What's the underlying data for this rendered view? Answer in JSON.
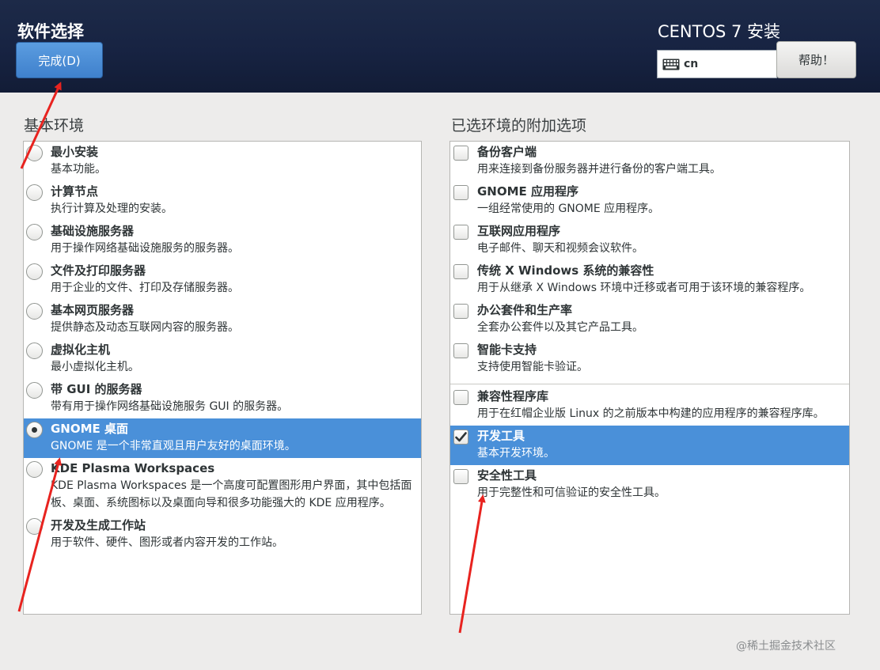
{
  "header": {
    "title": "软件选择",
    "done_label": "完成(D)",
    "product": "CENTOS 7 安装",
    "keyboard_layout": "cn",
    "help_label": "帮助！"
  },
  "base_env": {
    "heading": "基本环境",
    "items": [
      {
        "title": "最小安装",
        "desc": "基本功能。",
        "selected": false
      },
      {
        "title": "计算节点",
        "desc": "执行计算及处理的安装。",
        "selected": false
      },
      {
        "title": "基础设施服务器",
        "desc": "用于操作网络基础设施服务的服务器。",
        "selected": false
      },
      {
        "title": "文件及打印服务器",
        "desc": "用于企业的文件、打印及存储服务器。",
        "selected": false
      },
      {
        "title": "基本网页服务器",
        "desc": "提供静态及动态互联网内容的服务器。",
        "selected": false
      },
      {
        "title": "虚拟化主机",
        "desc": "最小虚拟化主机。",
        "selected": false
      },
      {
        "title": "带 GUI 的服务器",
        "desc": "带有用于操作网络基础设施服务 GUI 的服务器。",
        "selected": false
      },
      {
        "title": "GNOME 桌面",
        "desc": "GNOME 是一个非常直观且用户友好的桌面环境。",
        "selected": true
      },
      {
        "title": "KDE Plasma Workspaces",
        "desc": "KDE Plasma Workspaces 是一个高度可配置图形用户界面，其中包括面板、桌面、系统图标以及桌面向导和很多功能强大的 KDE 应用程序。",
        "selected": false
      },
      {
        "title": "开发及生成工作站",
        "desc": "用于软件、硬件、图形或者内容开发的工作站。",
        "selected": false
      }
    ]
  },
  "addons": {
    "heading": "已选环境的附加选项",
    "items": [
      {
        "title": "备份客户端",
        "desc": "用来连接到备份服务器并进行备份的客户端工具。",
        "checked": false,
        "selected": false
      },
      {
        "title": "GNOME 应用程序",
        "desc": "一组经常使用的 GNOME 应用程序。",
        "checked": false,
        "selected": false
      },
      {
        "title": "互联网应用程序",
        "desc": "电子邮件、聊天和视频会议软件。",
        "checked": false,
        "selected": false
      },
      {
        "title": "传统 X Windows 系统的兼容性",
        "desc": "用于从继承 X Windows 环境中迁移或者可用于该环境的兼容程序。",
        "checked": false,
        "selected": false
      },
      {
        "title": "办公套件和生产率",
        "desc": "全套办公套件以及其它产品工具。",
        "checked": false,
        "selected": false
      },
      {
        "title": "智能卡支持",
        "desc": "支持使用智能卡验证。",
        "checked": false,
        "selected": false
      },
      {
        "title": "兼容性程序库",
        "desc": "用于在红帽企业版 Linux 的之前版本中构建的应用程序的兼容程序库。",
        "checked": false,
        "selected": false
      },
      {
        "title": "开发工具",
        "desc": "基本开发环境。",
        "checked": true,
        "selected": true
      },
      {
        "title": "安全性工具",
        "desc": "用于完整性和可信验证的安全性工具。",
        "checked": false,
        "selected": false
      }
    ]
  },
  "watermark": "@稀土掘金技术社区",
  "colors": {
    "header_bg": "#172342",
    "accent": "#4a90d9",
    "annotation_arrow": "#e8231f"
  }
}
